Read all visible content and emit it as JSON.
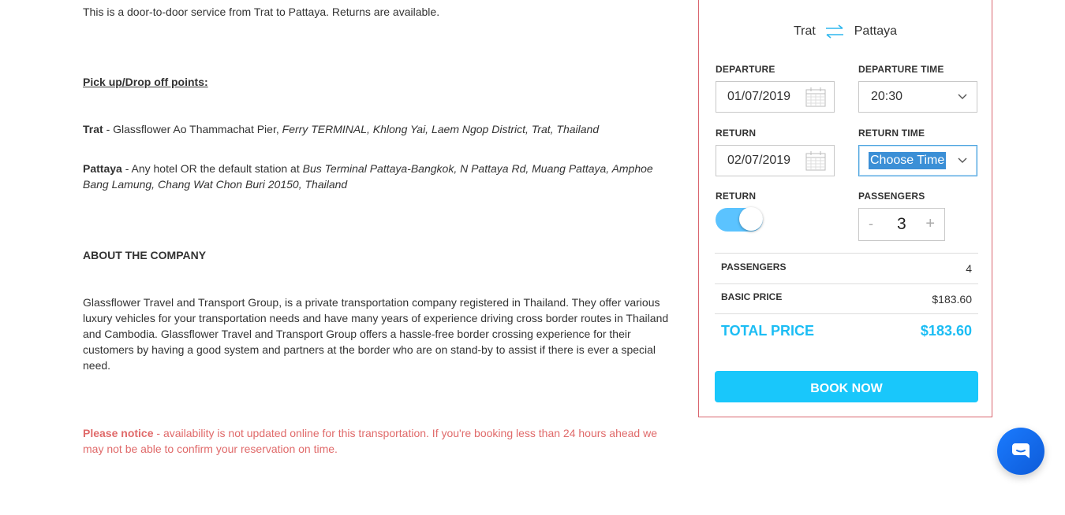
{
  "main": {
    "intro": "This is a door-to-door service from Trat to Pattaya. Returns are available.",
    "pickup_heading": "Pick up/Drop off points:",
    "trat_name": "Trat",
    "trat_plain": " - Glassflower Ao Thammachat Pier, ",
    "trat_italic": "Ferry TERMINAL, Khlong Yai, Laem Ngop District, Trat, Thailand",
    "pattaya_name": "Pattaya",
    "pattaya_plain": " - Any hotel OR the default station at ",
    "pattaya_italic": "Bus Terminal Pattaya-Bangkok, N Pattaya Rd, Muang Pattaya, Amphoe Bang Lamung, Chang Wat Chon Buri 20150, Thailand",
    "about_heading": "ABOUT THE COMPANY",
    "about_text": "Glassflower Travel and Transport Group, is a private transportation company registered in Thailand. They offer various luxury vehicles for your transportation needs and have many years of experience driving cross border routes in Thailand and Cambodia. Glassflower Travel and Transport Group offers a hassle-free border crossing experience for their customers by having a good system and partners at the border who are on stand-by to assist if there is ever a special need.",
    "notice_bold": "Please notice",
    "notice_text": " - availability is not updated online for this transportation. If you're booking less than 24 hours ahead we may not be able to confirm your reservation on time."
  },
  "booking": {
    "from": "Trat",
    "to": "Pattaya",
    "departure_label": "DEPARTURE",
    "departure_date": "01/07/2019",
    "departure_time_label": "DEPARTURE TIME",
    "departure_time": "20:30",
    "return_label": "RETURN",
    "return_date": "02/07/2019",
    "return_time_label": "RETURN TIME",
    "return_time": "Choose Time",
    "return_toggle_label": "RETURN",
    "return_toggle_on": true,
    "passengers_label": "PASSENGERS",
    "minus": "-",
    "passenger_count": "3",
    "plus": "+",
    "summary_passengers_label": "PASSENGERS",
    "summary_passengers": "4",
    "basic_price_label": "BASIC PRICE",
    "basic_price": "$183.60",
    "total_label": "TOTAL PRICE",
    "total_price": "$183.60",
    "book_label": "BOOK NOW"
  },
  "colors": {
    "accent": "#19c7fb",
    "panel_border": "#d9666f",
    "notice": "#e06a6a"
  }
}
